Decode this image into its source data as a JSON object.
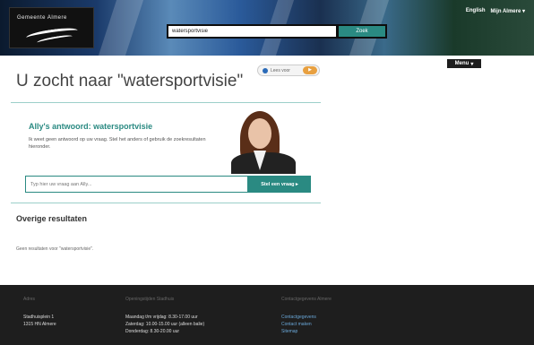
{
  "header": {
    "logo_text": "Gemeente Almere",
    "search_value": "watersportvisie",
    "search_button": "Zoek",
    "top_links": [
      "English",
      "Mijn Almere ▾"
    ],
    "menu_label": "Menu"
  },
  "main": {
    "title": "U zocht naar \"watersportvisie\"",
    "share_label": "Lees voor",
    "ally": {
      "title": "Ally's antwoord: watersportvisie",
      "text": "Ik weet geen antwoord op uw vraag. Stel het anders of gebruik de zoekresultaten hieronder.",
      "input_placeholder": "Typ hier uw vraag aan Ally...",
      "button_label": "Stel een vraag ▸"
    },
    "other_results_title": "Overige resultaten",
    "no_results_text": "Geen resultaten voor \"watersportvisie\"."
  },
  "footer": {
    "col1": {
      "heading": "Adres",
      "lines": [
        "Stadhuisplein 1",
        "1315 HN Almere"
      ]
    },
    "col2": {
      "heading": "Openingstijden Stadhuis",
      "lines": [
        "Maandag t/m vrijdag: 8.30-17.00 uur",
        "Zaterdag: 10.00-15.00 uur (alleen balie)",
        "Donderdag: 8.30-20.00 uur"
      ]
    },
    "col3": {
      "heading": "Contactgegevens Almere",
      "links": [
        "Contactgegevens",
        "Contact maken",
        "Sitemap"
      ]
    }
  },
  "colors": {
    "accent": "#2a8a82",
    "footer_bg": "#1e1e1e",
    "link": "#6aa7d8"
  }
}
